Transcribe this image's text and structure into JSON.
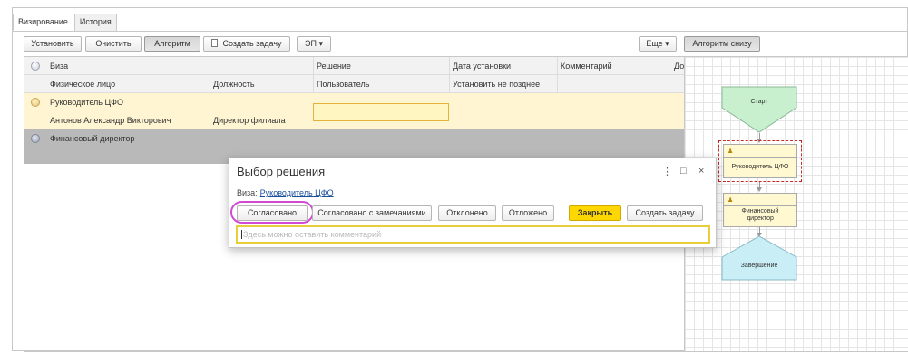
{
  "tabs": [
    {
      "label": "Визирование"
    },
    {
      "label": "История"
    }
  ],
  "toolbar": {
    "set": "Установить",
    "clear": "Очистить",
    "algorithm": "Алгоритм",
    "create_task": "Создать задачу",
    "ep": "ЭП",
    "more": "Еще",
    "algorithm_below": "Алгоритм снизу"
  },
  "grid": {
    "header": {
      "row1": [
        "Виза",
        "Решение",
        "Дата установки",
        "Комментарий",
        "Доб"
      ],
      "row2": [
        "Физическое лицо",
        "Должность",
        "Пользователь",
        "Установить не позднее"
      ]
    },
    "rows": [
      {
        "viza": "Руководитель ЦФО",
        "person": "Антонов Александр Викторович",
        "position": "Директор филиала"
      },
      {
        "viza": "Финансовый директор"
      }
    ]
  },
  "diagram": {
    "start": "Старт",
    "step1": "Руководитель ЦФО",
    "step2": "Финансовый директор",
    "end": "Завершение"
  },
  "dialog": {
    "title": "Выбор решения",
    "viza_label": "Виза:",
    "viza_link": "Руководитель ЦФО",
    "buttons": {
      "approved": "Согласовано",
      "approved_notes": "Согласовано с замечаниями",
      "rejected": "Отклонено",
      "postponed": "Отложено",
      "close": "Закрыть",
      "create_task": "Создать задачу"
    },
    "comment_placeholder": "Здесь можно оставить комментарий",
    "controls": {
      "menu": "⋮",
      "maximize": "□",
      "close": "×"
    }
  },
  "colors": {
    "row_yellow": "#fff5d2",
    "row_gray": "#b9b9b9",
    "close_button": "#ffd700",
    "highlight": "#d14ad6",
    "start_node": "#c8f0cf",
    "end_node": "#c9eef6",
    "step_node": "#fff8d0"
  },
  "icons": [
    "document-icon",
    "dropdown-arrow-icon",
    "user-icon",
    "status-circle-icon"
  ]
}
